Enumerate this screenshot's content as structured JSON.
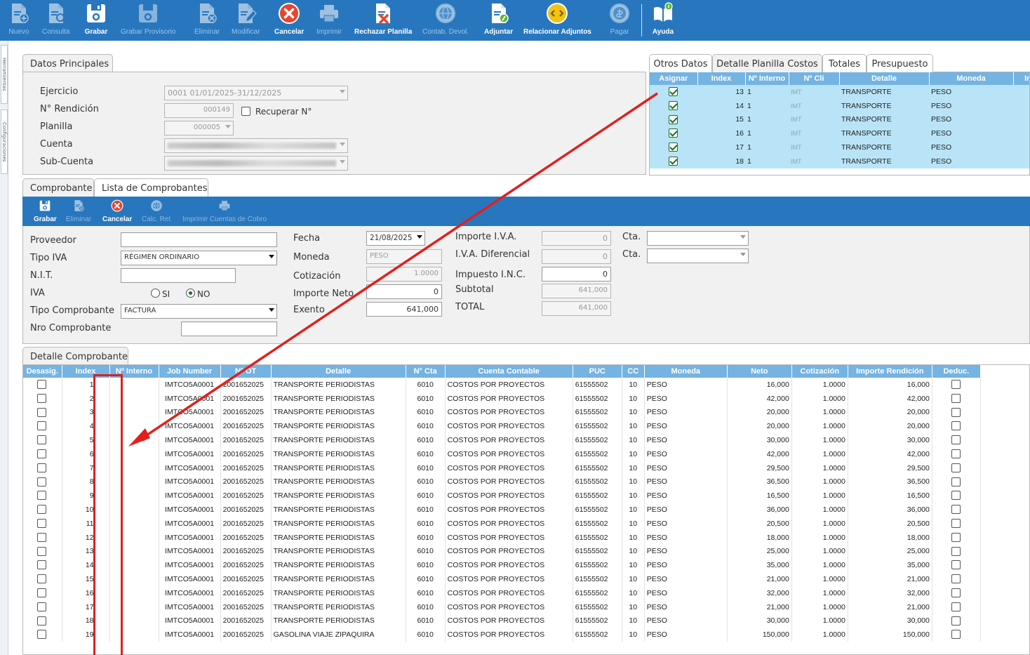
{
  "toolbar": {
    "buttons": [
      {
        "label": "Nuevo",
        "icon": "new-doc-icon",
        "enabled": false
      },
      {
        "label": "Consulta",
        "icon": "search-doc-icon",
        "enabled": false
      },
      {
        "label": "Grabar",
        "icon": "save-icon",
        "enabled": true
      },
      {
        "label": "Grabar Provisorio",
        "icon": "save-draft-icon",
        "enabled": false
      },
      {
        "label": "Eliminar",
        "icon": "delete-doc-icon",
        "enabled": false
      },
      {
        "label": "Modificar",
        "icon": "edit-doc-icon",
        "enabled": false
      },
      {
        "label": "Cancelar",
        "icon": "cancel-icon",
        "enabled": true
      },
      {
        "label": "Imprimir",
        "icon": "printer-icon",
        "enabled": false
      },
      {
        "label": "Rechazar Planilla",
        "icon": "reject-sheet-icon",
        "enabled": true
      },
      {
        "label": "Contab. Devol.",
        "icon": "globe-icon",
        "enabled": false
      },
      {
        "label": "Adjuntar",
        "icon": "attach-doc-icon",
        "enabled": true
      },
      {
        "label": "Relacionar Adjuntos",
        "icon": "link-attachments-icon",
        "enabled": true
      },
      {
        "label": "Pagar",
        "icon": "pay-icon",
        "enabled": false
      },
      {
        "label": "Ayuda",
        "icon": "help-book-icon",
        "enabled": true
      }
    ]
  },
  "left_strip": {
    "tab1": "Herramientas",
    "tab2": "Configuraciones"
  },
  "datos_principales": {
    "tab_label": "Datos Principales",
    "ejercicio_label": "Ejercicio",
    "ejercicio_value": "0001 01/01/2025-31/12/2025",
    "rendicion_label": "N° Rendición",
    "rendicion_value": "000149",
    "recuperar_label": "Recuperar N°",
    "planilla_label": "Planilla",
    "planilla_value": "000005",
    "cuenta_label": "Cuenta",
    "subcuenta_label": "Sub-Cuenta"
  },
  "right_tabs": [
    "Otros Datos",
    "Detalle Planilla Costos",
    "Totales",
    "Presupuesto"
  ],
  "planilla_grid": {
    "headers": [
      "Asignar",
      "Index",
      "Nº Interno",
      "Nº Cli",
      "Detalle",
      "Moneda",
      "In"
    ],
    "rows": [
      {
        "index": "13",
        "interno": "1",
        "cli": "IMT",
        "detalle": "TRANSPORTE",
        "moneda": "PESO"
      },
      {
        "index": "14",
        "interno": "1",
        "cli": "IMT",
        "detalle": "TRANSPORTE",
        "moneda": "PESO"
      },
      {
        "index": "15",
        "interno": "1",
        "cli": "IMT",
        "detalle": "TRANSPORTE",
        "moneda": "PESO"
      },
      {
        "index": "16",
        "interno": "1",
        "cli": "IMT",
        "detalle": "TRANSPORTE",
        "moneda": "PESO"
      },
      {
        "index": "17",
        "interno": "1",
        "cli": "IMT",
        "detalle": "TRANSPORTE",
        "moneda": "PESO"
      },
      {
        "index": "18",
        "interno": "1",
        "cli": "IMT",
        "detalle": "TRANSPORTE",
        "moneda": "PESO"
      }
    ]
  },
  "comprobante_tabs": [
    "Comprobante",
    "Lista de Comprobantes"
  ],
  "subtoolbar": [
    {
      "label": "Grabar",
      "icon": "save-icon",
      "enabled": true
    },
    {
      "label": "Eliminar",
      "icon": "delete-doc-icon",
      "enabled": false
    },
    {
      "label": "Cancelar",
      "icon": "cancel-icon",
      "enabled": true
    },
    {
      "label": "Calc. Ret",
      "icon": "globe-icon",
      "enabled": false
    },
    {
      "label": "Imprimir Cuentas de Cobro",
      "icon": "printer-icon",
      "enabled": false
    }
  ],
  "form": {
    "proveedor_label": "Proveedor",
    "tipo_iva_label": "Tipo IVA",
    "tipo_iva_value": "RÉGIMEN ORDINARIO",
    "nit_label": "N.I.T.",
    "iva_label": "IVA",
    "iva_si": "SI",
    "iva_no": "NO",
    "tipo_comp_label": "Tipo Comprobante",
    "tipo_comp_value": "FACTURA",
    "nro_comp_label": "Nro Comprobante",
    "fecha_label": "Fecha",
    "fecha_value": "21/08/2025",
    "moneda_label": "Moneda",
    "moneda_value": "PESO",
    "cotizacion_label": "Cotización",
    "cotizacion_value": "1.0000",
    "importe_neto_label": "Importe Neto",
    "importe_neto_value": "0",
    "exento_label": "Exento",
    "exento_value": "641,000",
    "importe_iva_label": "Importe I.V.A.",
    "importe_iva_value": "0",
    "iva_dif_label": "I.V.A. Diferencial",
    "iva_dif_value": "0",
    "inc_label": "Impuesto I.N.C.",
    "inc_value": "0",
    "subtotal_label": "Subtotal",
    "subtotal_value": "641,000",
    "total_label": "TOTAL",
    "total_value": "641,000",
    "cta_label": "Cta."
  },
  "detalle_tab": "Detalle Comprobante",
  "detalle_grid": {
    "headers": [
      "Desasig.",
      "Index",
      "Nº Interno",
      "Job Number",
      "Nº OT",
      "Detalle",
      "N° Cta",
      "Cuenta Contable",
      "PUC",
      "CC",
      "Moneda",
      "Neto",
      "Cotización",
      "Importe Rendición",
      "Deduc."
    ],
    "rows": [
      {
        "index": "1",
        "job": "IMTCO5A0001",
        "ot": "2001652025",
        "detalle": "TRANSPORTE PERIODISTAS",
        "cta": "6010",
        "cuenta": "COSTOS POR PROYECTOS",
        "puc": "61555502",
        "cc": "10",
        "moneda": "PESO",
        "neto": "16,000",
        "cot": "1.0000",
        "importe": "16,000"
      },
      {
        "index": "2",
        "job": "IMTCO5A0001",
        "ot": "2001652025",
        "detalle": "TRANSPORTE PERIODISTAS",
        "cta": "6010",
        "cuenta": "COSTOS POR PROYECTOS",
        "puc": "61555502",
        "cc": "10",
        "moneda": "PESO",
        "neto": "42,000",
        "cot": "1.0000",
        "importe": "42,000"
      },
      {
        "index": "3",
        "job": "IMTCO5A0001",
        "ot": "2001652025",
        "detalle": "TRANSPORTE PERIODISTAS",
        "cta": "6010",
        "cuenta": "COSTOS POR PROYECTOS",
        "puc": "61555502",
        "cc": "10",
        "moneda": "PESO",
        "neto": "20,000",
        "cot": "1.0000",
        "importe": "20,000"
      },
      {
        "index": "4",
        "job": "IMTCO5A0001",
        "ot": "2001652025",
        "detalle": "TRANSPORTE PERIODISTAS",
        "cta": "6010",
        "cuenta": "COSTOS POR PROYECTOS",
        "puc": "61555502",
        "cc": "10",
        "moneda": "PESO",
        "neto": "20,000",
        "cot": "1.0000",
        "importe": "20,000"
      },
      {
        "index": "5",
        "job": "IMTCO5A0001",
        "ot": "2001652025",
        "detalle": "TRANSPORTE PERIODISTAS",
        "cta": "6010",
        "cuenta": "COSTOS POR PROYECTOS",
        "puc": "61555502",
        "cc": "10",
        "moneda": "PESO",
        "neto": "30,000",
        "cot": "1.0000",
        "importe": "30,000"
      },
      {
        "index": "6",
        "job": "IMTCO5A0001",
        "ot": "2001652025",
        "detalle": "TRANSPORTE PERIODISTAS",
        "cta": "6010",
        "cuenta": "COSTOS POR PROYECTOS",
        "puc": "61555502",
        "cc": "10",
        "moneda": "PESO",
        "neto": "42,000",
        "cot": "1.0000",
        "importe": "42,000"
      },
      {
        "index": "7",
        "job": "IMTCO5A0001",
        "ot": "2001652025",
        "detalle": "TRANSPORTE PERIODISTAS",
        "cta": "6010",
        "cuenta": "COSTOS POR PROYECTOS",
        "puc": "61555502",
        "cc": "10",
        "moneda": "PESO",
        "neto": "29,500",
        "cot": "1.0000",
        "importe": "29,500"
      },
      {
        "index": "8",
        "job": "IMTCO5A0001",
        "ot": "2001652025",
        "detalle": "TRANSPORTE PERIODISTAS",
        "cta": "6010",
        "cuenta": "COSTOS POR PROYECTOS",
        "puc": "61555502",
        "cc": "10",
        "moneda": "PESO",
        "neto": "36,500",
        "cot": "1.0000",
        "importe": "36,500"
      },
      {
        "index": "9",
        "job": "IMTCO5A0001",
        "ot": "2001652025",
        "detalle": "TRANSPORTE PERIODISTAS",
        "cta": "6010",
        "cuenta": "COSTOS POR PROYECTOS",
        "puc": "61555502",
        "cc": "10",
        "moneda": "PESO",
        "neto": "16,500",
        "cot": "1.0000",
        "importe": "16,500"
      },
      {
        "index": "10",
        "job": "IMTCO5A0001",
        "ot": "2001652025",
        "detalle": "TRANSPORTE PERIODISTAS",
        "cta": "6010",
        "cuenta": "COSTOS POR PROYECTOS",
        "puc": "61555502",
        "cc": "10",
        "moneda": "PESO",
        "neto": "36,000",
        "cot": "1.0000",
        "importe": "36,000"
      },
      {
        "index": "11",
        "job": "IMTCO5A0001",
        "ot": "2001652025",
        "detalle": "TRANSPORTE PERIODISTAS",
        "cta": "6010",
        "cuenta": "COSTOS POR PROYECTOS",
        "puc": "61555502",
        "cc": "10",
        "moneda": "PESO",
        "neto": "20,500",
        "cot": "1.0000",
        "importe": "20,500"
      },
      {
        "index": "12",
        "job": "IMTCO5A0001",
        "ot": "2001652025",
        "detalle": "TRANSPORTE PERIODISTAS",
        "cta": "6010",
        "cuenta": "COSTOS POR PROYECTOS",
        "puc": "61555502",
        "cc": "10",
        "moneda": "PESO",
        "neto": "18,000",
        "cot": "1.0000",
        "importe": "18,000"
      },
      {
        "index": "13",
        "job": "IMTCO5A0001",
        "ot": "2001652025",
        "detalle": "TRANSPORTE PERIODISTAS",
        "cta": "6010",
        "cuenta": "COSTOS POR PROYECTOS",
        "puc": "61555502",
        "cc": "10",
        "moneda": "PESO",
        "neto": "25,000",
        "cot": "1.0000",
        "importe": "25,000"
      },
      {
        "index": "14",
        "job": "IMTCO5A0001",
        "ot": "2001652025",
        "detalle": "TRANSPORTE PERIODISTAS",
        "cta": "6010",
        "cuenta": "COSTOS POR PROYECTOS",
        "puc": "61555502",
        "cc": "10",
        "moneda": "PESO",
        "neto": "35,000",
        "cot": "1.0000",
        "importe": "35,000"
      },
      {
        "index": "15",
        "job": "IMTCO5A0001",
        "ot": "2001652025",
        "detalle": "TRANSPORTE PERIODISTAS",
        "cta": "6010",
        "cuenta": "COSTOS POR PROYECTOS",
        "puc": "61555502",
        "cc": "10",
        "moneda": "PESO",
        "neto": "21,000",
        "cot": "1.0000",
        "importe": "21,000"
      },
      {
        "index": "16",
        "job": "IMTCO5A0001",
        "ot": "2001652025",
        "detalle": "TRANSPORTE PERIODISTAS",
        "cta": "6010",
        "cuenta": "COSTOS POR PROYECTOS",
        "puc": "61555502",
        "cc": "10",
        "moneda": "PESO",
        "neto": "32,000",
        "cot": "1.0000",
        "importe": "32,000"
      },
      {
        "index": "17",
        "job": "IMTCO5A0001",
        "ot": "2001652025",
        "detalle": "TRANSPORTE PERIODISTAS",
        "cta": "6010",
        "cuenta": "COSTOS POR PROYECTOS",
        "puc": "61555502",
        "cc": "10",
        "moneda": "PESO",
        "neto": "21,000",
        "cot": "1.0000",
        "importe": "21,000"
      },
      {
        "index": "18",
        "job": "IMTCO5A0001",
        "ot": "2001652025",
        "detalle": "TRANSPORTE PERIODISTAS",
        "cta": "6010",
        "cuenta": "COSTOS POR PROYECTOS",
        "puc": "61555502",
        "cc": "10",
        "moneda": "PESO",
        "neto": "30,000",
        "cot": "1.0000",
        "importe": "30,000"
      },
      {
        "index": "19",
        "job": "IMTCO5A0001",
        "ot": "2001652025",
        "detalle": "GASOLINA VIAJE ZIPAQUIRA",
        "cta": "6010",
        "cuenta": "COSTOS POR PROYECTOS",
        "puc": "61555502",
        "cc": "10",
        "moneda": "PESO",
        "neto": "150,000",
        "cot": "1.0000",
        "importe": "150,000"
      }
    ]
  },
  "colors": {
    "toolbar": "#2877be",
    "grid_header": "#74b3e2",
    "grid_selected": "#b9e4f7",
    "annotation": "#e0201e"
  }
}
